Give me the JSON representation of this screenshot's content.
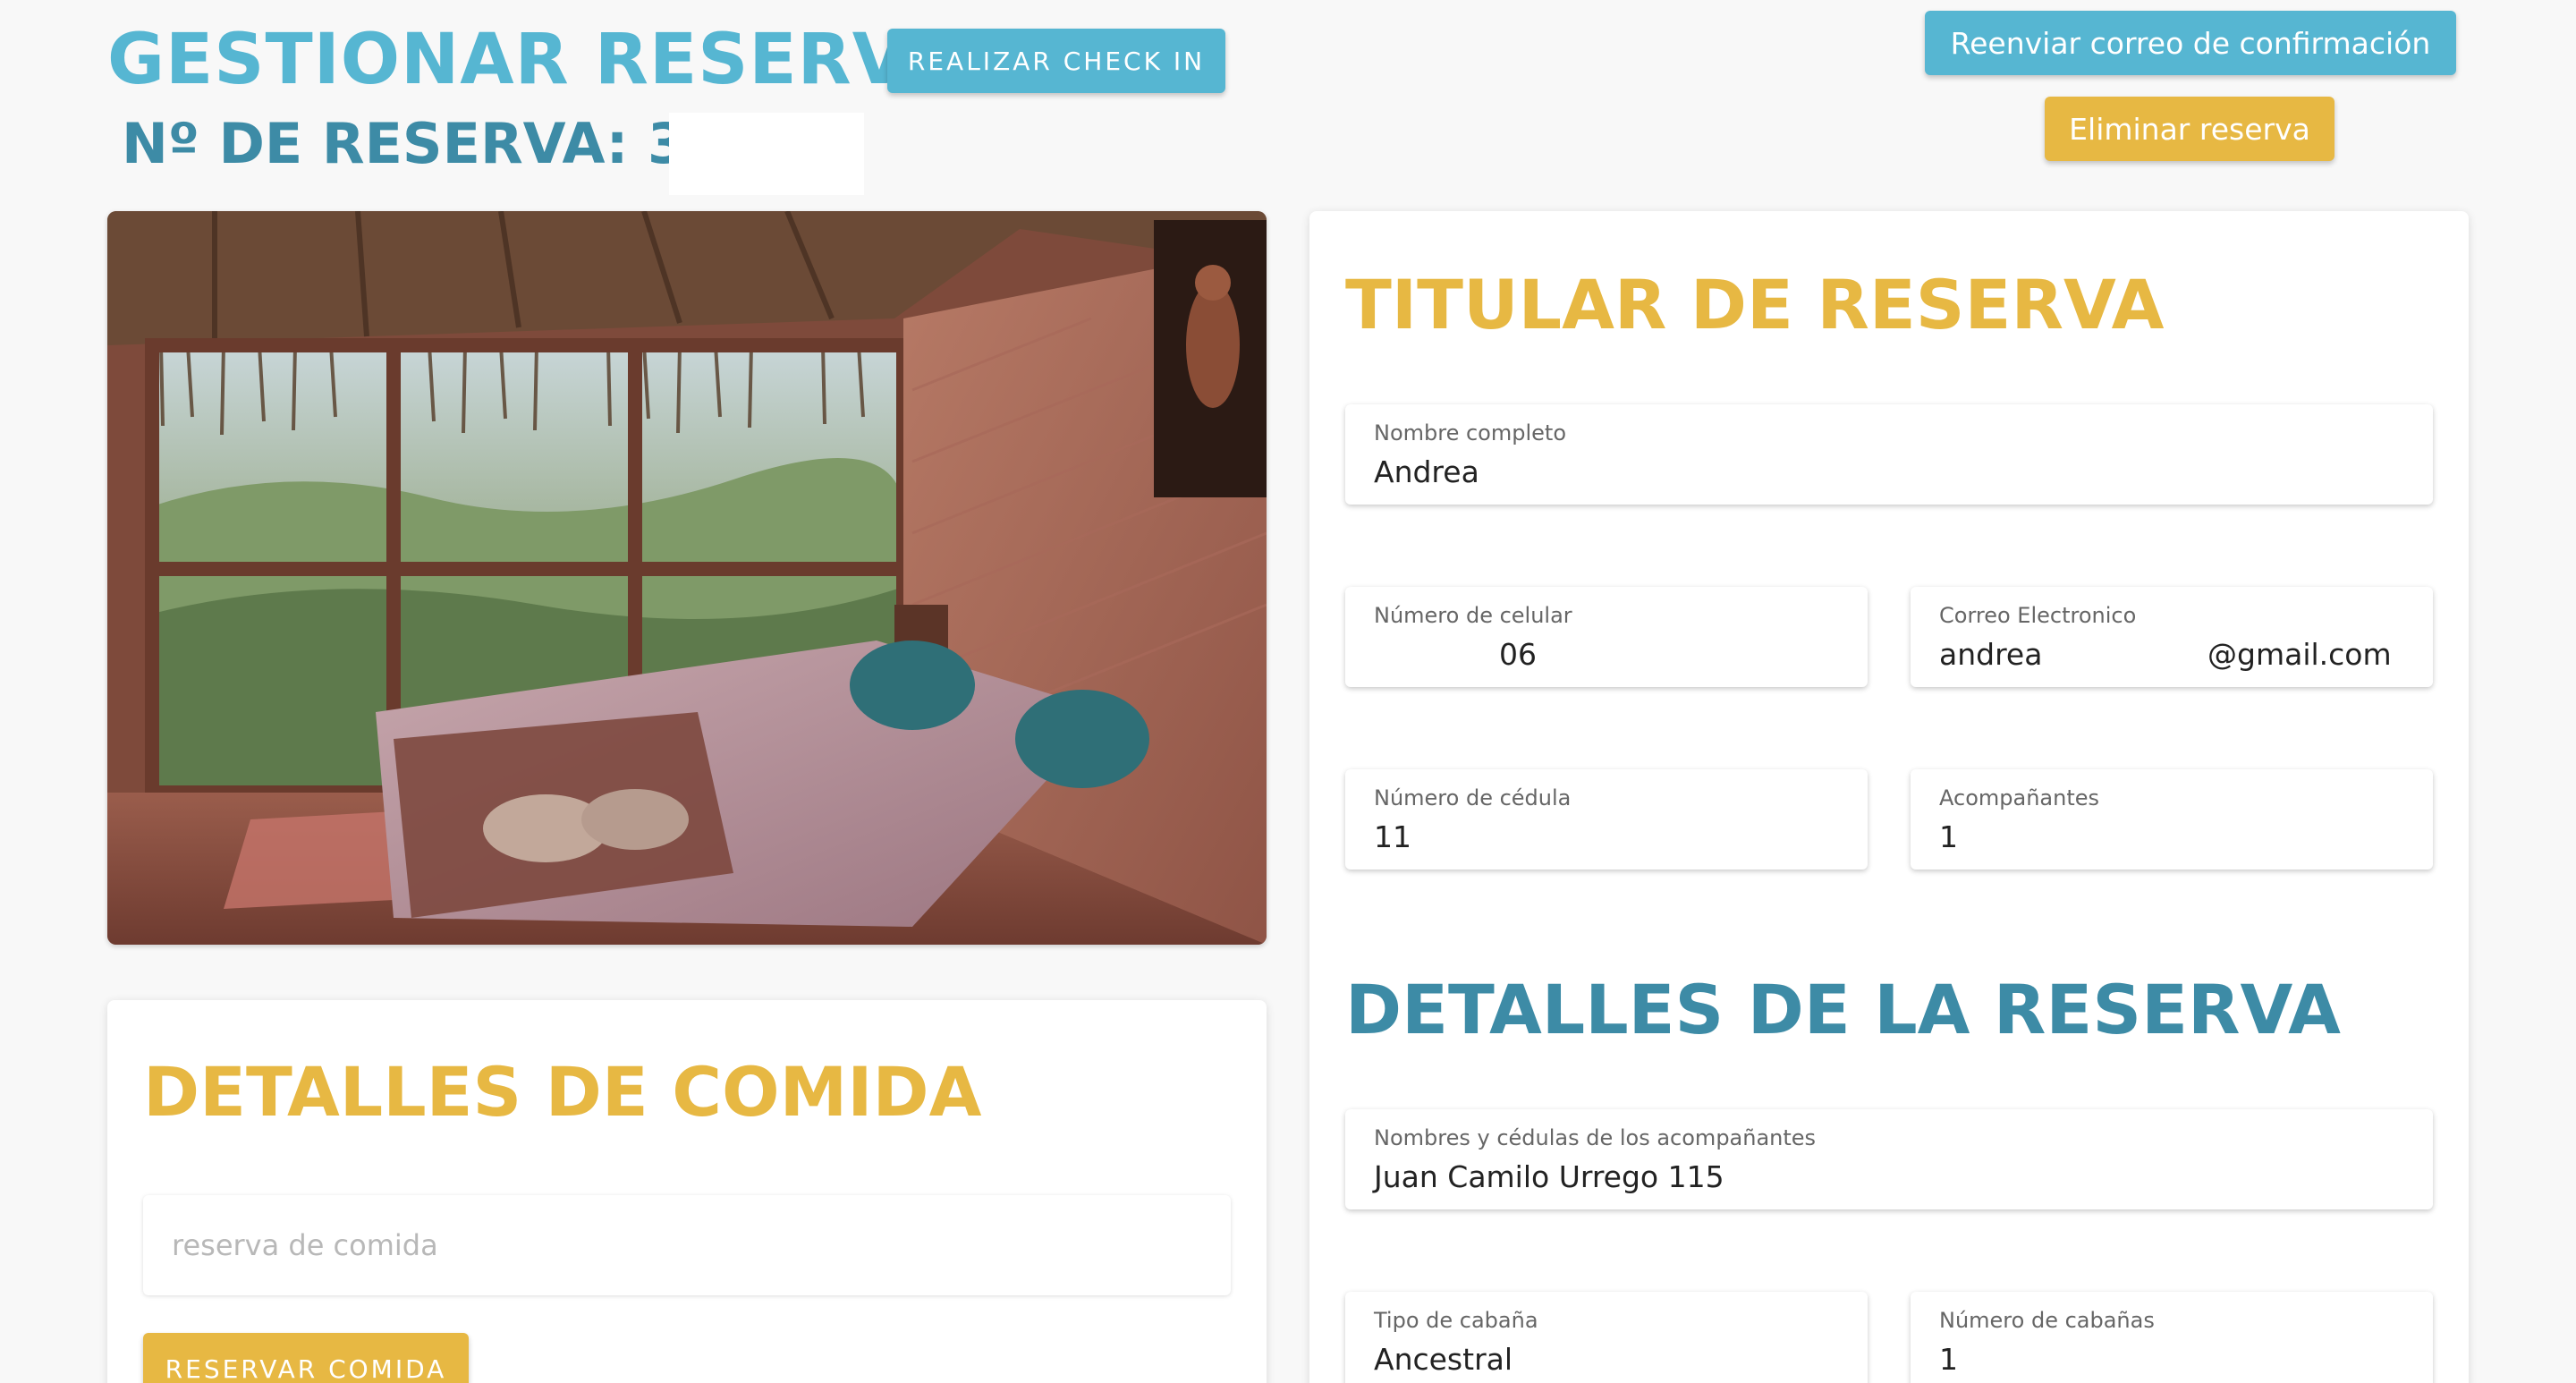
{
  "header": {
    "title": "GESTIONAR RESERVA",
    "reservation_label": "Nº DE RESERVA: 324",
    "checkin_button": "REALIZAR CHECK IN",
    "resend_button": "Reenviar correo de confirmación",
    "delete_button": "Eliminar reserva"
  },
  "colors": {
    "primary_teal": "#56b6d2",
    "dark_teal": "#3d8ba6",
    "accent_yellow": "#e7b843",
    "background": "#f8f8f8"
  },
  "photo": {
    "icon": "room-photo"
  },
  "food": {
    "title": "DETALLES DE COMIDA",
    "input_placeholder": "reserva de comida",
    "input_value": "",
    "button": "RESERVAR COMIDA"
  },
  "holder": {
    "title": "TITULAR DE RESERVA",
    "full_name": {
      "label": "Nombre completo",
      "value": "Andrea"
    },
    "phone": {
      "label": "Número de celular",
      "value": "06"
    },
    "email": {
      "label": "Correo Electronico",
      "value": "andrea",
      "suffix": "@gmail.com"
    },
    "id_number": {
      "label": "Número de cédula",
      "value": "11"
    },
    "companions": {
      "label": "Acompañantes",
      "value": "1"
    }
  },
  "details": {
    "title": "DETALLES DE LA RESERVA",
    "companions_names": {
      "label": "Nombres y cédulas de los acompañantes",
      "value": "Juan Camilo Urrego 115"
    },
    "cabin_type": {
      "label": "Tipo de cabaña",
      "value": "Ancestral"
    },
    "cabin_count": {
      "label": "Número de cabañas",
      "value": "1"
    }
  }
}
